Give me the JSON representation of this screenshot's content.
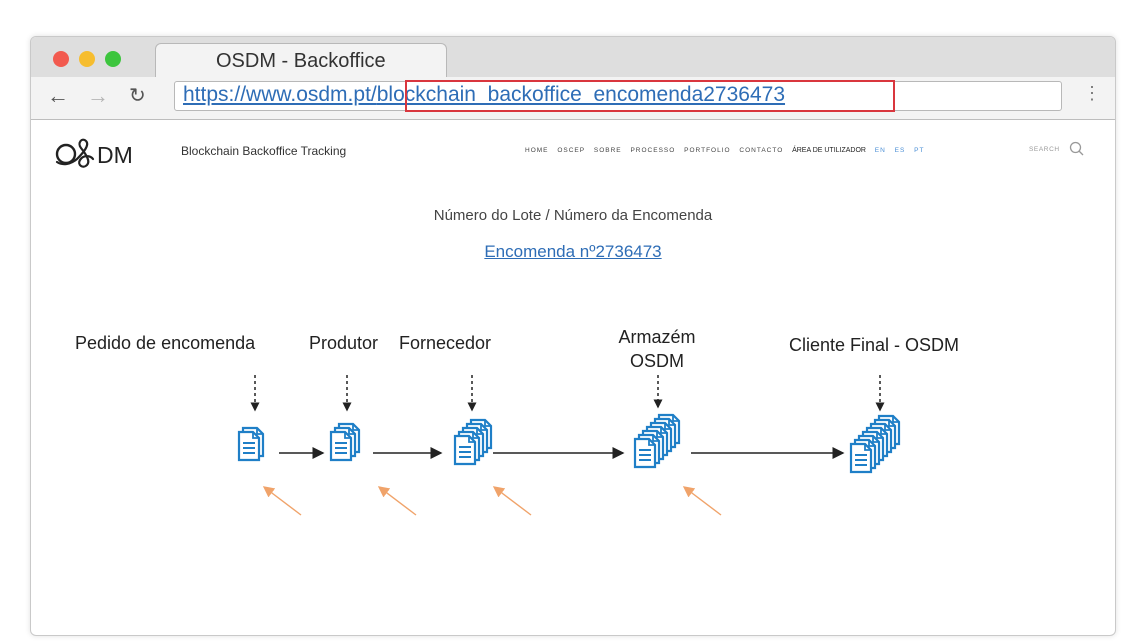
{
  "browser": {
    "tab_title": "OSDM - Backoffice",
    "url_prefix": "https://www.osdm.pt/",
    "url_path": "blockchain_backoffice_encomenda2736473",
    "menu": "⋮"
  },
  "site": {
    "logo": "O&DM",
    "tagline": "Blockchain Backoffice Tracking",
    "nav": [
      "HOME",
      "OSCEP",
      "SOBRE",
      "PROCESSO",
      "PORTFOLIO",
      "CONTACTO"
    ],
    "user_area": "ÁREA DE UTILIZADOR",
    "languages": [
      "EN",
      "ES",
      "PT"
    ],
    "search_placeholder": "SEARCH"
  },
  "content": {
    "lot_label": "Número do Lote / Número da Encomenda",
    "order_link": "Encomenda nº2736473",
    "stages": [
      {
        "label": "Pedido de encomenda"
      },
      {
        "label": "Produtor"
      },
      {
        "label": "Fornecedor"
      },
      {
        "label_line1": "Armazém",
        "label_line2": "OSDM"
      },
      {
        "label": "Cliente Final - OSDM"
      }
    ]
  },
  "colors": {
    "doc_blue": "#1f7fc7",
    "arrow_orange": "#f0a36a",
    "link_blue": "#2e6db6",
    "highlight_red": "#d9363e"
  }
}
